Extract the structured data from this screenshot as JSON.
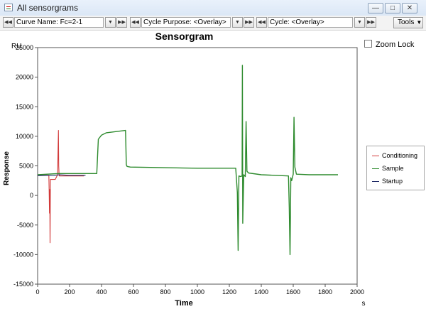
{
  "window": {
    "title": "All sensorgrams"
  },
  "toolbar": {
    "curve_name": "Curve Name: Fc=2-1",
    "cycle_purpose": "Cycle Purpose: <Overlay>",
    "cycle": "Cycle: <Overlay>",
    "tools_label": "Tools"
  },
  "zoom_lock_label": "Zoom Lock",
  "chart_data": {
    "type": "line",
    "title": "Sensorgram",
    "xlabel": "Time",
    "ylabel": "Response",
    "y_unit": "RU",
    "x_unit": "s",
    "xlim": [
      0,
      2000
    ],
    "ylim": [
      -15000,
      25000
    ],
    "x_ticks": [
      0,
      200,
      400,
      600,
      800,
      1000,
      1200,
      1400,
      1600,
      1800,
      2000
    ],
    "y_ticks": [
      -15000,
      -10000,
      -5000,
      0,
      5000,
      10000,
      15000,
      20000,
      25000
    ],
    "legend_position": "right",
    "series": [
      {
        "name": "Conditioning",
        "color": "#d23a3a",
        "x": [
          0,
          70,
          72,
          74,
          76,
          78,
          80,
          110,
          125,
          130,
          132,
          134,
          136,
          140,
          200,
          290
        ],
        "y": [
          3400,
          3400,
          1000,
          -3000,
          1000,
          -8000,
          2700,
          2700,
          3500,
          11000,
          5000,
          3500,
          3300,
          3300,
          3300,
          3300
        ]
      },
      {
        "name": "Sample",
        "color": "#2e8b2e",
        "x": [
          0,
          130,
          370,
          380,
          400,
          430,
          550,
          555,
          560,
          580,
          1000,
          1240,
          1250,
          1255,
          1260,
          1270,
          1280,
          1282,
          1284,
          1290,
          1300,
          1305,
          1310,
          1320,
          1400,
          1570,
          1575,
          1580,
          1585,
          1590,
          1600,
          1605,
          1610,
          1620,
          1700,
          1880
        ],
        "y": [
          3500,
          3700,
          3700,
          9500,
          10200,
          10600,
          11000,
          5200,
          4900,
          4800,
          4600,
          4600,
          500,
          -9300,
          3300,
          3200,
          3300,
          22000,
          -4700,
          3500,
          3200,
          12500,
          4100,
          3800,
          3500,
          3300,
          -2000,
          -10000,
          3000,
          2500,
          3600,
          13200,
          4800,
          3600,
          3500,
          3500
        ]
      },
      {
        "name": "Startup",
        "color": "#1f2a66",
        "x": [
          0,
          100,
          140,
          200,
          300
        ],
        "y": [
          3350,
          3400,
          3500,
          3400,
          3400
        ]
      }
    ]
  }
}
